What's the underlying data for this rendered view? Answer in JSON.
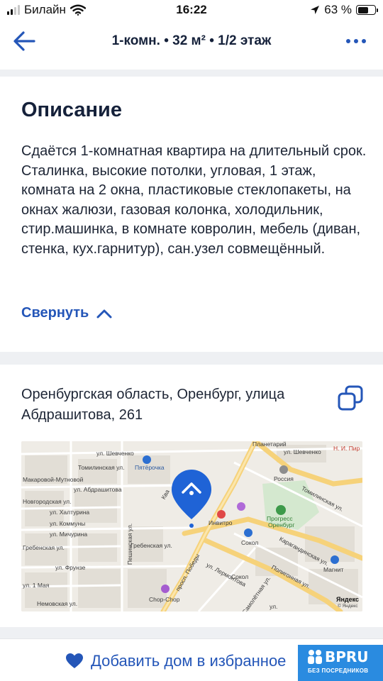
{
  "status_bar": {
    "carrier": "Билайн",
    "time": "16:22",
    "battery": "63 %",
    "battery_level": 0.63
  },
  "nav": {
    "title": "1-комн.  •  32 м²  •  1/2 этаж",
    "back_icon": "arrow-left-icon",
    "more_icon": "more-dots-icon"
  },
  "description": {
    "title": "Описание",
    "text": "Сдаётся 1-комнатная квартира на длительный срок. Сталинка, высокие потолки, угловая, 1 этаж, комната на 2 окна, пластиковые стеклопакеты, на окнах жалюзи, газовая колонка, холодильник, стир.машинка, в комнате ковролин, мебель (диван, стенка, кух.гарнитур), сан.узел совмещённый.",
    "collapse_label": "Свернуть"
  },
  "location": {
    "address": "Оренбургская область, Оренбург, улица Абдрашитова, 261",
    "copy_icon": "copy-icon"
  },
  "map": {
    "labels": {
      "planetariy": "Планетарий",
      "npir": "Н. И. Пир",
      "shevchenko_1": "ул. Шевченко",
      "shevchenko_2": "ул. Шевченко",
      "tominlinskaya_1": "Томилинская ул.",
      "tominlinskaya_2": "Томилинская ул.",
      "pyaterochka": "Пятёрочка",
      "rossiya": "Россия",
      "makarovoy": "Макаровой-Мутновой",
      "abdrashitova": "ул. Абдрашитова",
      "novgorodskaya": "Новгородская ул.",
      "khaltyrina": "ул. Халтурина",
      "kommuny": "ул. Коммуны",
      "michurina": "ул. Мичурина",
      "grebenskaya_1": "Гребенская ул.",
      "grebenskaya_2": "Гребенская ул.",
      "frunze": "ул. Фрунзе",
      "first_maya": "ул. 1 Мая",
      "nemovskaya": "Немовская ул.",
      "peshinskaya": "Пешинская ул.",
      "invitro": "Инвитро",
      "sokol_1": "Сокол",
      "sokol_2": "Сокол",
      "progress_1": "Прогресс",
      "progress_2": "Оренбург",
      "pobedy": "просп. Победы",
      "lermontova": "ул. Лермонтова",
      "karagandinskaya": "Карагандинская ул.",
      "poligonnaya": "Полигонная ул.",
      "samolyotnaya": "Самолётная ул.",
      "chopchop": "Chop-Chop",
      "magnit": "Магнит",
      "yandex": "Яндекс",
      "yandex_copy": "© Яндекс",
      "kommunal": "ул.",
      "kva": "Ква"
    }
  },
  "bottom": {
    "favorite_label": "Добавить дом в избранное",
    "heart_icon": "heart-icon",
    "logo_text": "BPRU",
    "logo_sub": "БЕЗ ПОСРЕДНИКОВ"
  },
  "colors": {
    "accent": "#2456b8",
    "text": "#15213a",
    "divider": "#eef0f3",
    "logo_bg": "#2a8be0"
  }
}
